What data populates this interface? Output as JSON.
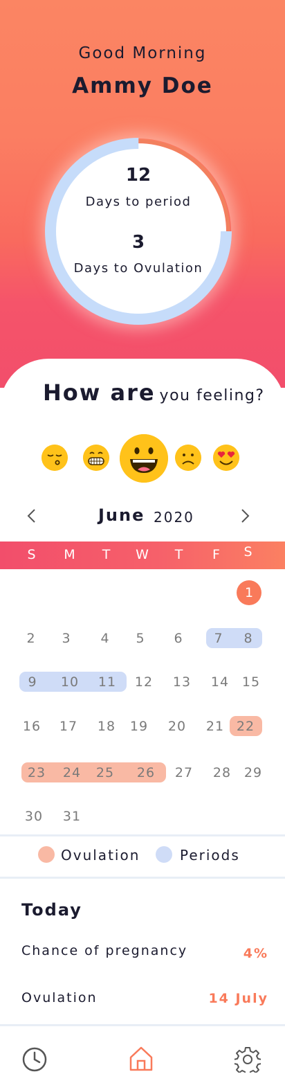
{
  "header": {
    "greeting": "Good Morning",
    "user_name": "Ammy Doe"
  },
  "cycle": {
    "days_to_period": "12",
    "days_to_period_label": "Days to period",
    "days_to_ovulation": "3",
    "days_to_ovulation_label": "Days to Ovulation",
    "cycle_progress": 0.75
  },
  "mood": {
    "title_bold": "How are",
    "title_light": "you feeling?",
    "options": [
      {
        "name": "sleepy-face-icon",
        "selected": false
      },
      {
        "name": "grinning-face-icon",
        "selected": false
      },
      {
        "name": "laughing-face-icon",
        "selected": true
      },
      {
        "name": "sad-face-icon",
        "selected": false
      },
      {
        "name": "heart-eyes-face-icon",
        "selected": false
      }
    ]
  },
  "calendar": {
    "month": "June",
    "year": "2020",
    "weekdays": [
      "S",
      "M",
      "T",
      "W",
      "T",
      "F",
      "S"
    ],
    "days": [
      "1",
      "2",
      "3",
      "4",
      "5",
      "6",
      "7",
      "8",
      "9",
      "10",
      "11",
      "12",
      "13",
      "14",
      "15",
      "16",
      "17",
      "18",
      "19",
      "20",
      "21",
      "22",
      "23",
      "24",
      "25",
      "26",
      "27",
      "28",
      "29",
      "30",
      "31"
    ],
    "selected_day": "1",
    "period_days": [
      "7",
      "8",
      "9",
      "10",
      "11"
    ],
    "ovulation_days": [
      "22",
      "23",
      "24",
      "25",
      "26"
    ]
  },
  "legend": {
    "ovulation_label": "Ovulation",
    "periods_label": "Periods"
  },
  "today": {
    "title": "Today",
    "rows": [
      {
        "label": "Chance of pregnancy",
        "value": "4%"
      },
      {
        "label": "Ovulation",
        "value": "14 July"
      }
    ]
  },
  "colors": {
    "accent": "#f97a5a",
    "period": "#cfdcf7",
    "ovulation": "#f9b9a4",
    "emoji": "#ffc21a"
  },
  "tabs": [
    {
      "name": "history-tab",
      "icon": "clock-icon",
      "active": false
    },
    {
      "name": "home-tab",
      "icon": "home-icon",
      "active": true
    },
    {
      "name": "settings-tab",
      "icon": "gear-icon",
      "active": false
    }
  ]
}
